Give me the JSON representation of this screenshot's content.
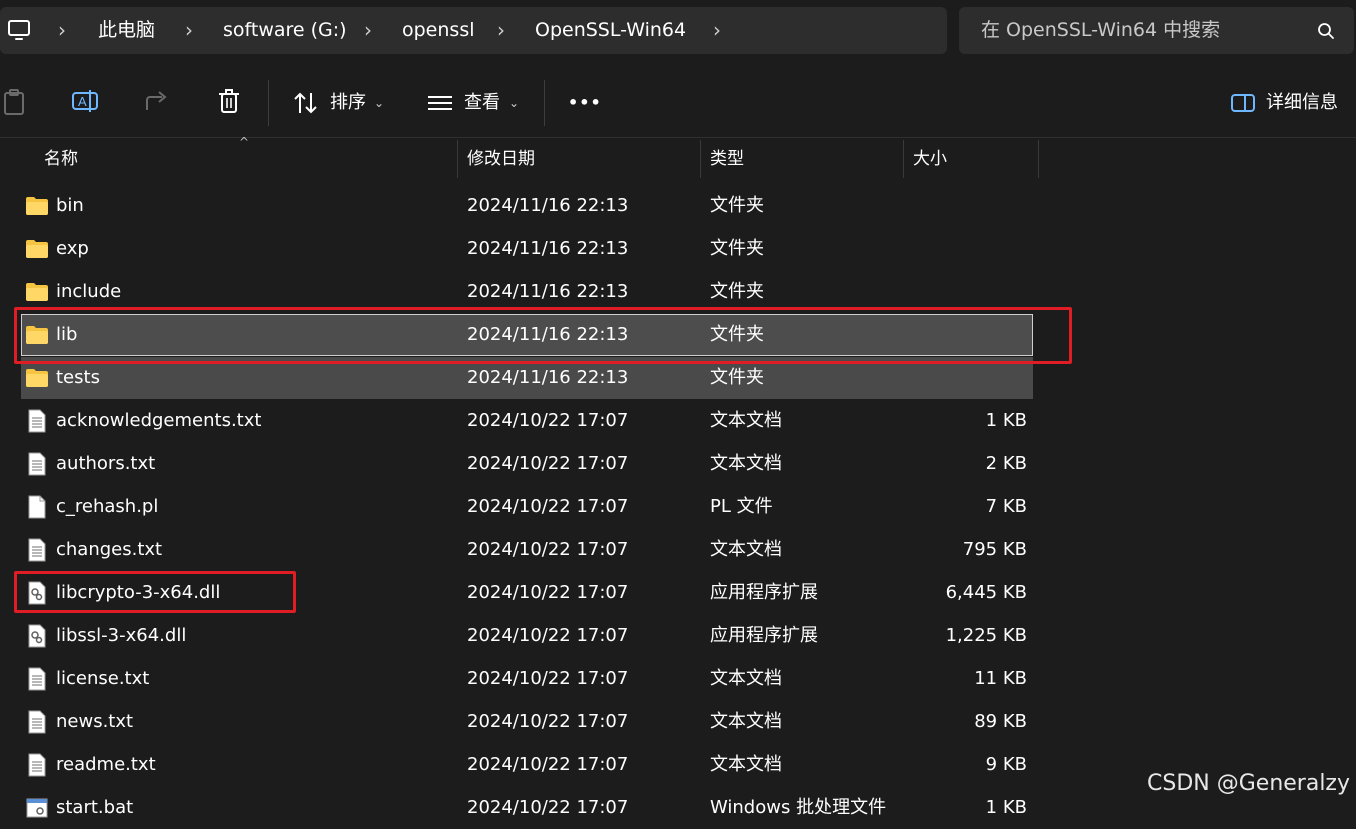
{
  "address_bar": {
    "icon": "computer-icon",
    "breadcrumbs": [
      "此电脑",
      "software (G:)",
      "openssl",
      "OpenSSL-Win64"
    ]
  },
  "search": {
    "placeholder": "在 OpenSSL-Win64 中搜索"
  },
  "toolbar": {
    "sort_label": "排序",
    "view_label": "查看",
    "more_label": "•••",
    "details_label": "详细信息"
  },
  "columns": {
    "name": "名称",
    "modified": "修改日期",
    "type": "类型",
    "size": "大小"
  },
  "files": [
    {
      "name": "bin",
      "date": "2024/11/16 22:13",
      "type": "文件夹",
      "size": "",
      "icon": "folder-icon"
    },
    {
      "name": "exp",
      "date": "2024/11/16 22:13",
      "type": "文件夹",
      "size": "",
      "icon": "folder-icon"
    },
    {
      "name": "include",
      "date": "2024/11/16 22:13",
      "type": "文件夹",
      "size": "",
      "icon": "folder-icon"
    },
    {
      "name": "lib",
      "date": "2024/11/16 22:13",
      "type": "文件夹",
      "size": "",
      "icon": "folder-icon",
      "selected": true,
      "focused": true
    },
    {
      "name": "tests",
      "date": "2024/11/16 22:13",
      "type": "文件夹",
      "size": "",
      "icon": "folder-icon",
      "selected": true
    },
    {
      "name": "acknowledgements.txt",
      "date": "2024/10/22 17:07",
      "type": "文本文档",
      "size": "1 KB",
      "icon": "text-file-icon"
    },
    {
      "name": "authors.txt",
      "date": "2024/10/22 17:07",
      "type": "文本文档",
      "size": "2 KB",
      "icon": "text-file-icon"
    },
    {
      "name": "c_rehash.pl",
      "date": "2024/10/22 17:07",
      "type": "PL 文件",
      "size": "7 KB",
      "icon": "blank-file-icon"
    },
    {
      "name": "changes.txt",
      "date": "2024/10/22 17:07",
      "type": "文本文档",
      "size": "795 KB",
      "icon": "text-file-icon"
    },
    {
      "name": "libcrypto-3-x64.dll",
      "date": "2024/10/22 17:07",
      "type": "应用程序扩展",
      "size": "6,445 KB",
      "icon": "dll-file-icon"
    },
    {
      "name": "libssl-3-x64.dll",
      "date": "2024/10/22 17:07",
      "type": "应用程序扩展",
      "size": "1,225 KB",
      "icon": "dll-file-icon"
    },
    {
      "name": "license.txt",
      "date": "2024/10/22 17:07",
      "type": "文本文档",
      "size": "11 KB",
      "icon": "text-file-icon"
    },
    {
      "name": "news.txt",
      "date": "2024/10/22 17:07",
      "type": "文本文档",
      "size": "89 KB",
      "icon": "text-file-icon"
    },
    {
      "name": "readme.txt",
      "date": "2024/10/22 17:07",
      "type": "文本文档",
      "size": "9 KB",
      "icon": "text-file-icon"
    },
    {
      "name": "start.bat",
      "date": "2024/10/22 17:07",
      "type": "Windows 批处理文件",
      "size": "1 KB",
      "icon": "bat-file-icon"
    }
  ],
  "watermark": "CSDN @Generalzy",
  "colors": {
    "background": "#1c1c1c",
    "selection": "#4a4a4a",
    "highlight_box": "#e01d25",
    "folder": "#f5c542"
  }
}
